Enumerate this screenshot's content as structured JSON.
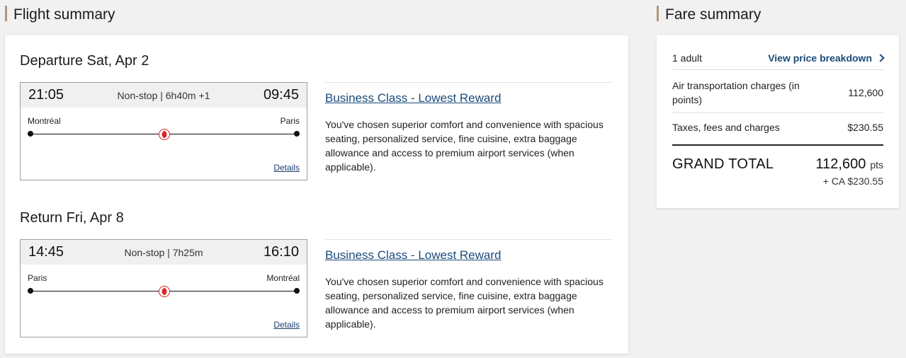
{
  "flight_summary": {
    "title": "Flight summary",
    "legs": [
      {
        "heading": "Departure Sat, Apr 2",
        "dep_time": "21:05",
        "arr_time": "09:45",
        "info": "Non-stop | 6h40m +1",
        "origin": "Montréal",
        "destination": "Paris",
        "details_label": "Details",
        "fare_name": "Business Class - Lowest Reward",
        "fare_description": "You've chosen superior comfort and convenience with spacious seating, personalized service, fine cuisine, extra baggage allowance and access to premium airport services (when applicable)."
      },
      {
        "heading": "Return Fri, Apr 8",
        "dep_time": "14:45",
        "arr_time": "16:10",
        "info": "Non-stop | 7h25m",
        "origin": "Paris",
        "destination": "Montréal",
        "details_label": "Details",
        "fare_name": "Business Class - Lowest Reward",
        "fare_description": "You've chosen superior comfort and convenience with spacious seating, personalized service, fine cuisine, extra baggage allowance and access to premium airport services (when applicable)."
      }
    ]
  },
  "fare_summary": {
    "title": "Fare summary",
    "passengers": "1 adult",
    "view_breakdown": "View price breakdown",
    "air_label": "Air transportation charges (in points)",
    "air_value": "112,600",
    "taxes_label": "Taxes, fees and charges",
    "taxes_value": "$230.55",
    "grand_label": "GRAND TOTAL",
    "grand_points": "112,600",
    "grand_unit": "pts",
    "grand_cash": "+ CA $230.55"
  },
  "icons": {
    "airline": "maple-leaf-icon",
    "chevron": "chevron-right-icon"
  },
  "colors": {
    "accent_bar": "#b09a7c",
    "link": "#1a4b7a",
    "airline_red": "#d8262b"
  }
}
